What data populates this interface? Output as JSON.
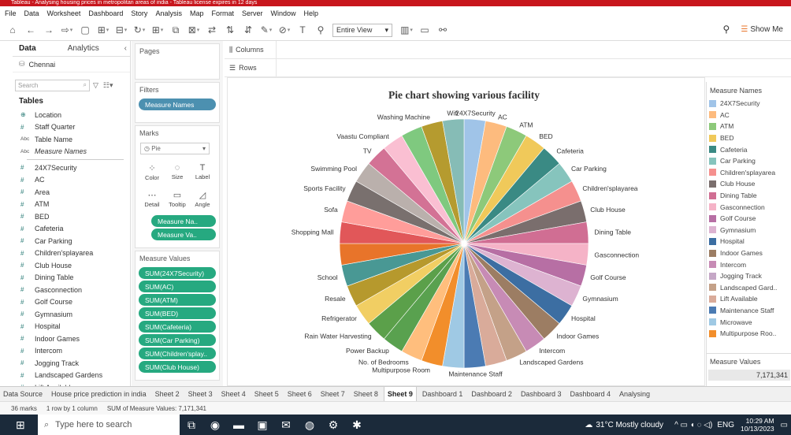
{
  "window": {
    "title": "Tableau - Analysing housing prices in metropolitan areas of india - Tableau license expires in 12 days"
  },
  "menu": [
    "File",
    "Data",
    "Worksheet",
    "Dashboard",
    "Story",
    "Analysis",
    "Map",
    "Format",
    "Server",
    "Window",
    "Help"
  ],
  "toolbar": {
    "view_select": "Entire View",
    "show_me": "Show Me"
  },
  "data_pane": {
    "tab_data": "Data",
    "tab_analytics": "Analytics",
    "datasource": "Chennai",
    "search_placeholder": "Search",
    "tables_heading": "Tables",
    "fields": [
      {
        "icon": "⊕",
        "label": "Location"
      },
      {
        "icon": "#",
        "label": "Staff Quarter"
      },
      {
        "icon": "Abc",
        "label": "Table Name"
      },
      {
        "icon": "Abc",
        "label": "Measure Names"
      },
      {
        "icon": "#",
        "label": "24X7Security"
      },
      {
        "icon": "#",
        "label": "AC"
      },
      {
        "icon": "#",
        "label": "Area"
      },
      {
        "icon": "#",
        "label": "ATM"
      },
      {
        "icon": "#",
        "label": "BED"
      },
      {
        "icon": "#",
        "label": "Cafeteria"
      },
      {
        "icon": "#",
        "label": "Car Parking"
      },
      {
        "icon": "#",
        "label": "Children'splayarea"
      },
      {
        "icon": "#",
        "label": "Club House"
      },
      {
        "icon": "#",
        "label": "Dining Table"
      },
      {
        "icon": "#",
        "label": "Gasconnection"
      },
      {
        "icon": "#",
        "label": "Golf Course"
      },
      {
        "icon": "#",
        "label": "Gymnasium"
      },
      {
        "icon": "#",
        "label": "Hospital"
      },
      {
        "icon": "#",
        "label": "Indoor Games"
      },
      {
        "icon": "#",
        "label": "Intercom"
      },
      {
        "icon": "#",
        "label": "Jogging Track"
      },
      {
        "icon": "#",
        "label": "Landscaped Gardens"
      },
      {
        "icon": "#",
        "label": "Lift Available"
      }
    ]
  },
  "cards": {
    "pages": "Pages",
    "filters": "Filters",
    "filter_pill": "Measure Names",
    "marks": "Marks",
    "mark_type": "Pie",
    "mark_buttons": [
      {
        "icon": "⁘",
        "label": "Color"
      },
      {
        "icon": "◌",
        "label": "Size"
      },
      {
        "icon": "T",
        "label": "Label"
      },
      {
        "icon": "⋯",
        "label": "Detail"
      },
      {
        "icon": "▭",
        "label": "Tooltip"
      },
      {
        "icon": "◿",
        "label": "Angle"
      }
    ],
    "mark_pills": [
      "Measure Na..",
      "Measure Va.."
    ],
    "measure_values": "Measure Values",
    "measure_pills": [
      "SUM(24X7Security)",
      "SUM(AC)",
      "SUM(ATM)",
      "SUM(BED)",
      "SUM(Cafeteria)",
      "SUM(Car Parking)",
      "SUM(Children'splay..",
      "SUM(Club House)"
    ]
  },
  "shelves": {
    "columns": "Columns",
    "rows": "Rows"
  },
  "legend": {
    "title": "Measure Names",
    "items": [
      {
        "label": "24X7Security",
        "color": "#a0c4e8"
      },
      {
        "label": "AC",
        "color": "#fdbb7e"
      },
      {
        "label": "ATM",
        "color": "#8dc97a"
      },
      {
        "label": "BED",
        "color": "#f0c95a"
      },
      {
        "label": "Cafeteria",
        "color": "#3a8a84"
      },
      {
        "label": "Car Parking",
        "color": "#86c4bd"
      },
      {
        "label": "Children'splayarea",
        "color": "#f5908e"
      },
      {
        "label": "Club House",
        "color": "#7a6e6d"
      },
      {
        "label": "Dining Table",
        "color": "#d06e93"
      },
      {
        "label": "Gasconnection",
        "color": "#f5b3c7"
      },
      {
        "label": "Golf Course",
        "color": "#b76fa4"
      },
      {
        "label": "Gymnasium",
        "color": "#ddb3d1"
      },
      {
        "label": "Hospital",
        "color": "#3c6ea2"
      },
      {
        "label": "Indoor Games",
        "color": "#9c7d63"
      },
      {
        "label": "Intercom",
        "color": "#c78bb5"
      },
      {
        "label": "Jogging Track",
        "color": "#c5a7c6"
      },
      {
        "label": "Landscaped Gard..",
        "color": "#c4a188"
      },
      {
        "label": "Lift Available",
        "color": "#d9ab9a"
      },
      {
        "label": "Maintenance Staff",
        "color": "#4b7bb3"
      },
      {
        "label": "Microwave",
        "color": "#9fc9e4"
      },
      {
        "label": "Multipurpose Roo..",
        "color": "#f28e2b"
      }
    ],
    "measure_values_title": "Measure Values",
    "measure_values_total": "7,171,341"
  },
  "sheet_tabs": [
    "Data Source",
    "House price prediction in india",
    "Sheet 2",
    "Sheet 3",
    "Sheet 4",
    "Sheet 5",
    "Sheet 6",
    "Sheet 7",
    "Sheet 8",
    "Sheet 9",
    "Dashboard 1",
    "Dashboard 2",
    "Dashboard 3",
    "Dashboard 4",
    "Analysing"
  ],
  "active_tab": "Sheet 9",
  "status": {
    "marks": "36 marks",
    "rows": "1 row by 1 column",
    "sum": "SUM of Measure Values: 7,171,341"
  },
  "taskbar": {
    "search": "Type here to search",
    "weather": "31°C  Mostly cloudy",
    "lang": "ENG",
    "time": "10:29 AM",
    "date": "10/13/2023"
  },
  "chart_data": {
    "type": "pie",
    "title": "Pie chart showing various facility",
    "total": 7171341,
    "slices": [
      {
        "label": "24X7Security",
        "share": 0.0278,
        "color": "#a0c4e8"
      },
      {
        "label": "AC",
        "share": 0.0278,
        "color": "#fdbb7e"
      },
      {
        "label": "ATM",
        "share": 0.0278,
        "color": "#8dc97a"
      },
      {
        "label": "BED",
        "share": 0.0278,
        "color": "#f0c95a"
      },
      {
        "label": "Cafeteria",
        "share": 0.0278,
        "color": "#3a8a84"
      },
      {
        "label": "Car Parking",
        "share": 0.0278,
        "color": "#86c4bd"
      },
      {
        "label": "Children'splayarea",
        "share": 0.0278,
        "color": "#f5908e"
      },
      {
        "label": "Club House",
        "share": 0.0278,
        "color": "#7a6e6d"
      },
      {
        "label": "Dining Table",
        "share": 0.0278,
        "color": "#d06e93"
      },
      {
        "label": "Gasconnection",
        "share": 0.0278,
        "color": "#f5b3c7"
      },
      {
        "label": "Golf Course",
        "share": 0.0278,
        "color": "#b76fa4"
      },
      {
        "label": "Gymnasium",
        "share": 0.0278,
        "color": "#ddb3d1"
      },
      {
        "label": "Hospital",
        "share": 0.0278,
        "color": "#3c6ea2"
      },
      {
        "label": "Indoor Games",
        "share": 0.0278,
        "color": "#9c7d63"
      },
      {
        "label": "Intercom",
        "share": 0.0278,
        "color": "#c78bb5"
      },
      {
        "label": "Landscaped Gardens",
        "share": 0.0278,
        "color": "#c4a188"
      },
      {
        "label": "",
        "share": 0.0278,
        "color": "#d9ab9a"
      },
      {
        "label": "Maintenance Staff",
        "share": 0.0278,
        "color": "#4b7bb3"
      },
      {
        "label": "",
        "share": 0.0278,
        "color": "#9fc9e4"
      },
      {
        "label": "Multipurpose Room",
        "share": 0.0278,
        "color": "#f28e2b"
      },
      {
        "label": "No. of Bedrooms",
        "share": 0.0278,
        "color": "#ffbe7d"
      },
      {
        "label": "Power Backup",
        "share": 0.0278,
        "color": "#59a14f"
      },
      {
        "label": "Rain Water Harvesting",
        "share": 0.0278,
        "color": "#5ba04a"
      },
      {
        "label": "Refrigerator",
        "share": 0.0278,
        "color": "#f1ce63"
      },
      {
        "label": "Resale",
        "share": 0.0278,
        "color": "#b6992d"
      },
      {
        "label": "School",
        "share": 0.0278,
        "color": "#499894"
      },
      {
        "label": "",
        "share": 0.0278,
        "color": "#e8742a"
      },
      {
        "label": "Shopping Mall",
        "share": 0.0278,
        "color": "#e15759"
      },
      {
        "label": "Sofa",
        "share": 0.0278,
        "color": "#ff9d9a"
      },
      {
        "label": "Sports Facility",
        "share": 0.0278,
        "color": "#79706e"
      },
      {
        "label": "Swimming Pool",
        "share": 0.0278,
        "color": "#bab0ac"
      },
      {
        "label": "TV",
        "share": 0.0278,
        "color": "#d37295"
      },
      {
        "label": "Vaastu Compliant",
        "share": 0.0278,
        "color": "#fabfd2"
      },
      {
        "label": "",
        "share": 0.0278,
        "color": "#7fc97f"
      },
      {
        "label": "Washing Machine",
        "share": 0.0278,
        "color": "#b59b2f"
      },
      {
        "label": "Wifi",
        "share": 0.0278,
        "color": "#86bcb6"
      }
    ]
  }
}
